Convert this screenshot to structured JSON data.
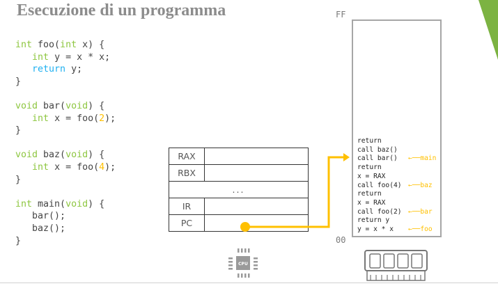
{
  "title": "Esecuzione di un programma",
  "code": [
    [
      [
        "kw",
        "int"
      ],
      [
        "t",
        " foo("
      ],
      [
        "kw",
        "int"
      ],
      [
        "t",
        " x) {"
      ]
    ],
    [
      [
        "t",
        "   "
      ],
      [
        "kw",
        "int"
      ],
      [
        "t",
        " y = x * x;"
      ]
    ],
    [
      [
        "t",
        "   "
      ],
      [
        "ret",
        "return"
      ],
      [
        "t",
        " y;"
      ]
    ],
    [
      [
        "t",
        "}"
      ]
    ],
    [
      [
        "t",
        ""
      ]
    ],
    [
      [
        "kw",
        "void"
      ],
      [
        "t",
        " bar("
      ],
      [
        "kw",
        "void"
      ],
      [
        "t",
        ") {"
      ]
    ],
    [
      [
        "t",
        "   "
      ],
      [
        "kw",
        "int"
      ],
      [
        "t",
        " x = foo("
      ],
      [
        "num",
        "2"
      ],
      [
        "t",
        ");"
      ]
    ],
    [
      [
        "t",
        "}"
      ]
    ],
    [
      [
        "t",
        ""
      ]
    ],
    [
      [
        "kw",
        "void"
      ],
      [
        "t",
        " baz("
      ],
      [
        "kw",
        "void"
      ],
      [
        "t",
        ") {"
      ]
    ],
    [
      [
        "t",
        "   "
      ],
      [
        "kw",
        "int"
      ],
      [
        "t",
        " x = foo("
      ],
      [
        "num",
        "4"
      ],
      [
        "t",
        ");"
      ]
    ],
    [
      [
        "t",
        "}"
      ]
    ],
    [
      [
        "t",
        ""
      ]
    ],
    [
      [
        "kw",
        "int"
      ],
      [
        "t",
        " main("
      ],
      [
        "kw",
        "void"
      ],
      [
        "t",
        ") {"
      ]
    ],
    [
      [
        "t",
        "   bar();"
      ]
    ],
    [
      [
        "t",
        "   baz();"
      ]
    ],
    [
      [
        "t",
        "}"
      ]
    ]
  ],
  "registers": {
    "rax": "RAX",
    "rbx": "RBX",
    "dots": "...",
    "ir": "IR",
    "pc": "PC"
  },
  "memory": {
    "top_addr": "FF",
    "bottom_addr": "00",
    "lines": [
      "return",
      "call baz()",
      "call bar()",
      "return",
      "x = RAX",
      "call foo(4)",
      "return",
      "x = RAX",
      "call foo(2)",
      "return y",
      "y = x * x"
    ],
    "tags": [
      {
        "line": 2,
        "label": "main"
      },
      {
        "line": 5,
        "label": "baz"
      },
      {
        "line": 8,
        "label": "bar"
      },
      {
        "line": 10,
        "label": "foo"
      }
    ]
  },
  "cpu_label": "CPU",
  "colors": {
    "accent": "#ffc000",
    "keyword": "#8dc63f",
    "return": "#1fb0f0"
  }
}
